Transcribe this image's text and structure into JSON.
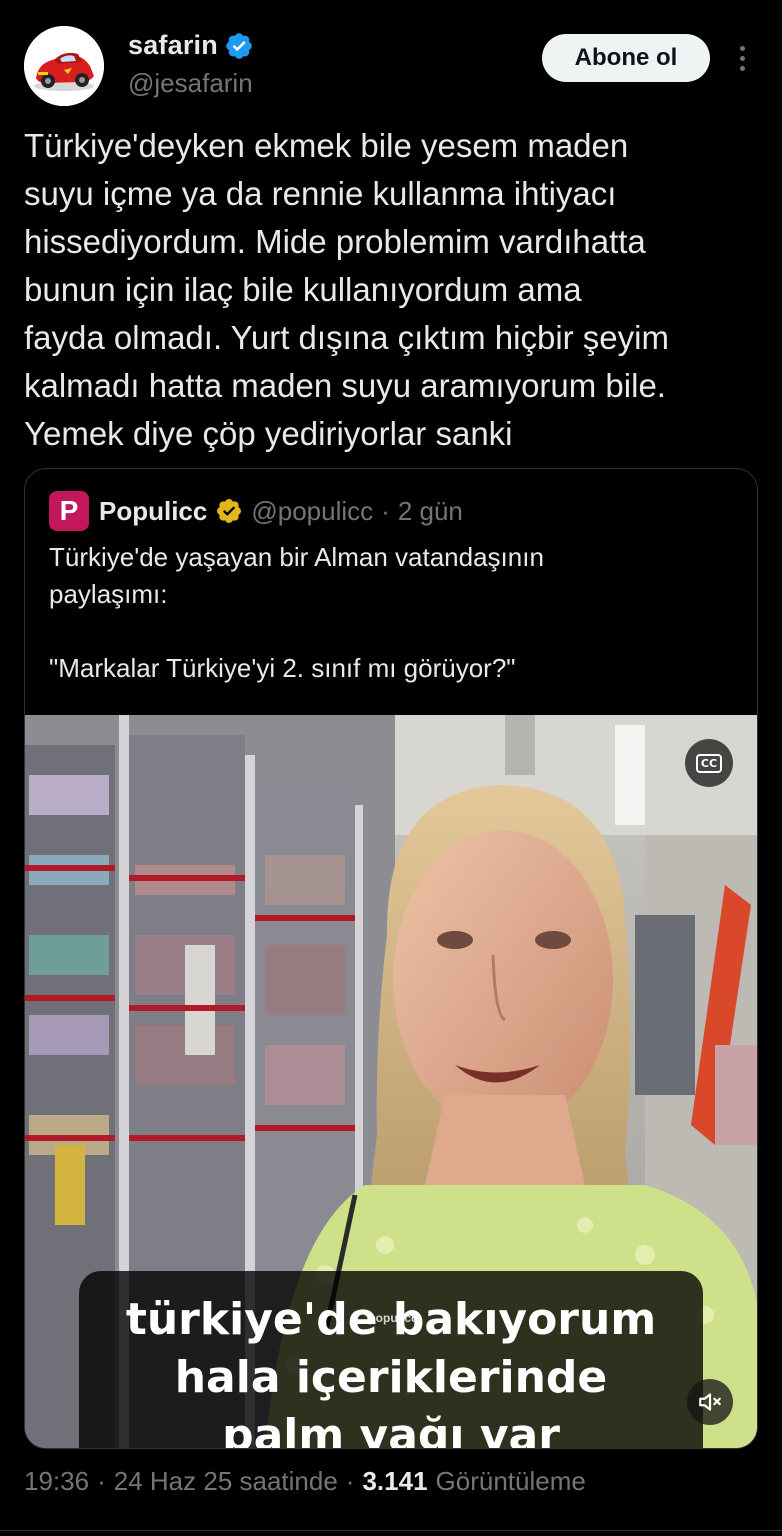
{
  "author": {
    "name": "safarin",
    "handle": "@jesafarin",
    "follow_label": "Abone ol"
  },
  "tweet": {
    "text": "Türkiye'deyken ekmek bile yesem maden\nsuyu içme ya da rennie kullanma ihtiyacı\nhissediyordum. Mide problemim vardıhatta\nbunun için ilaç bile kullanıyordum ama\nfayda olmadı. Yurt dışına çıktım hiçbir şeyim\nkalmadı hatta maden suyu aramıyorum bile.\nYemek diye çöp yediriyorlar sanki"
  },
  "quote": {
    "avatar_letter": "P",
    "name": "Populicc",
    "handle": "@populicc",
    "separator": "·",
    "time": "2 gün",
    "text": "Türkiye'de yaşayan bir Alman vatandaşının\npaylaşımı:\n\n\"Markalar Türkiye'yi 2. sınıf mı görüyor?\"",
    "media": {
      "cc_label": "CC",
      "caption": "türkiye'de bakıyorum\nhala içeriklerinde\npalm yağı var",
      "watermark": "populicc"
    }
  },
  "meta": {
    "time": "19:36",
    "sep1": "·",
    "date": "24 Haz 25 saatinde",
    "sep2": "·",
    "views_count": "3.141",
    "views_label": "Görüntüleme"
  },
  "colors": {
    "background": "#000000",
    "text_primary": "#e7e9ea",
    "text_secondary": "#71767b",
    "verified_blue": "#1d9bf0",
    "verified_gold": "#e2b719",
    "populicc_brand": "#c2185b"
  },
  "icons": {
    "verified": "verified-badge-icon",
    "gold_verified": "gold-verified-badge-icon",
    "more": "more-dots-icon",
    "cc": "closed-captions-icon",
    "mute": "muted-speaker-icon"
  }
}
